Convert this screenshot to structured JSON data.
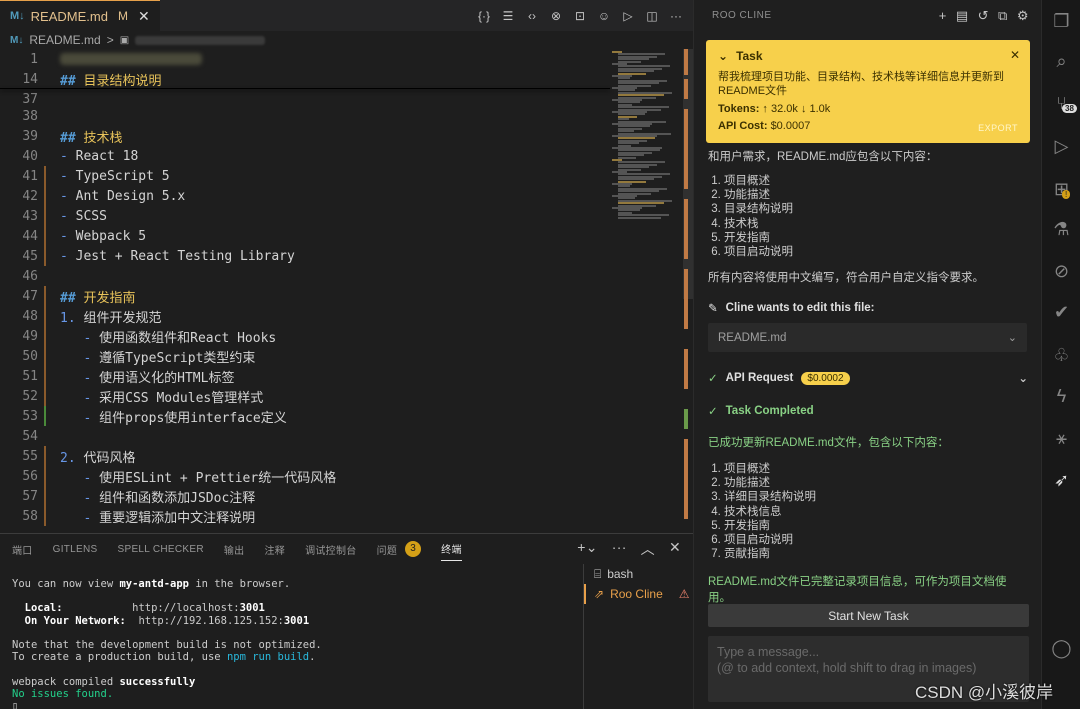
{
  "editor": {
    "tab": {
      "icon_text": "M↓",
      "filename": "README.md",
      "modified": "M"
    },
    "breadcrumb": {
      "icon_text": "M↓",
      "filename": "README.md",
      "separator": ">"
    },
    "lines": [
      {
        "n": "1",
        "text": ""
      },
      {
        "n": "14",
        "prefix": "## ",
        "text": "目录结构说明",
        "kind": "heading"
      },
      {
        "n": "37",
        "text": ""
      },
      {
        "n": "38",
        "text": ""
      },
      {
        "n": "39",
        "prefix": "## ",
        "text": "技术栈",
        "kind": "heading"
      },
      {
        "n": "40",
        "prefix": "- ",
        "text": "React 18",
        "kind": "bullet"
      },
      {
        "n": "41",
        "prefix": "- ",
        "text": "TypeScript 5",
        "kind": "bullet"
      },
      {
        "n": "42",
        "prefix": "- ",
        "text": "Ant Design 5.x",
        "kind": "bullet"
      },
      {
        "n": "43",
        "prefix": "- ",
        "text": "SCSS",
        "kind": "bullet"
      },
      {
        "n": "44",
        "prefix": "- ",
        "text": "Webpack 5",
        "kind": "bullet"
      },
      {
        "n": "45",
        "prefix": "- ",
        "text": "Jest + React Testing Library",
        "kind": "bullet"
      },
      {
        "n": "46",
        "text": ""
      },
      {
        "n": "47",
        "prefix": "## ",
        "text": "开发指南",
        "kind": "heading"
      },
      {
        "n": "48",
        "prefix": "1. ",
        "text": "组件开发规范",
        "kind": "ordered"
      },
      {
        "n": "49",
        "prefix": "   - ",
        "text": "使用函数组件和React Hooks",
        "kind": "bullet"
      },
      {
        "n": "50",
        "prefix": "   - ",
        "text": "遵循TypeScript类型约束",
        "kind": "bullet"
      },
      {
        "n": "51",
        "prefix": "   - ",
        "text": "使用语义化的HTML标签",
        "kind": "bullet"
      },
      {
        "n": "52",
        "prefix": "   - ",
        "text": "采用CSS Modules管理样式",
        "kind": "bullet"
      },
      {
        "n": "53",
        "prefix": "   - ",
        "text": "组件props使用interface定义",
        "kind": "bullet"
      },
      {
        "n": "54",
        "text": ""
      },
      {
        "n": "55",
        "prefix": "2. ",
        "text": "代码风格",
        "kind": "ordered"
      },
      {
        "n": "56",
        "prefix": "   - ",
        "text": "使用ESLint + Prettier统一代码风格",
        "kind": "bullet"
      },
      {
        "n": "57",
        "prefix": "   - ",
        "text": "组件和函数添加JSDoc注释",
        "kind": "bullet"
      },
      {
        "n": "58",
        "prefix": "   - ",
        "text": "重要逻辑添加中文注释说明",
        "kind": "bullet"
      }
    ]
  },
  "panel": {
    "tabs": [
      "端口",
      "GITLENS",
      "SPELL CHECKER",
      "输出",
      "注释",
      "调试控制台",
      "问题",
      "终端"
    ],
    "problems_count": "3",
    "active_tab": "终端",
    "terminal": {
      "l1a": "You can now view ",
      "l1b": "my-antd-app",
      "l1c": " in the browser.",
      "local_label": "  Local:",
      "local_url": "http://localhost:",
      "local_port": "3001",
      "net_label": "  On Your Network:",
      "net_url": "http://192.168.125.152:",
      "net_port": "3001",
      "n1": "Note that the development build is not optimized.",
      "n2a": "To create a production build, use ",
      "n2b": "npm run build",
      "n2c": ".",
      "w1a": "webpack compiled ",
      "w1b": "successfully",
      "w2": "No issues found."
    },
    "terminal_list": [
      {
        "label": "bash"
      },
      {
        "label": "Roo Cline"
      }
    ]
  },
  "cline": {
    "header": "ROO CLINE",
    "task": {
      "title": "Task",
      "text": "帮我梳理项目功能、目录结构、技术栈等详细信息并更新到README文件",
      "tokens_label": "Tokens:",
      "tokens_value": "↑ 32.0k ↓ 1.0k",
      "cost_label": "API Cost:",
      "cost_value": "$0.0007",
      "export": "EXPORT"
    },
    "intro": "和用户需求，README.md应包含以下内容：",
    "plan_items": [
      "项目概述",
      "功能描述",
      "目录结构说明",
      "技术栈",
      "开发指南",
      "项目启动说明"
    ],
    "note": "所有内容将使用中文编写，符合用户自定义指令要求。",
    "edit_label": "Cline wants to edit this file:",
    "file": "README.md",
    "api_request": "API Request",
    "api_cost": "$0.0002",
    "task_completed": "Task Completed",
    "done_intro": "已成功更新README.md文件，包含以下内容：",
    "done_items": [
      "项目概述",
      "功能描述",
      "详细目录结构说明",
      "技术栈信息",
      "开发指南",
      "项目启动说明",
      "贡献指南"
    ],
    "done_outro": "README.md文件已完整记录项目信息，可作为项目文档使用。",
    "start_button": "Start New Task",
    "input_placeholder1": "Type a message...",
    "input_placeholder2": "(@ to add context, hold shift to drag in images)"
  },
  "activity": {
    "scm_badge": "38"
  },
  "watermark": "CSDN @小溪彼岸",
  "colors": {
    "accent": "#f7d04b",
    "success": "#89d185",
    "heading": "#569cd6"
  }
}
